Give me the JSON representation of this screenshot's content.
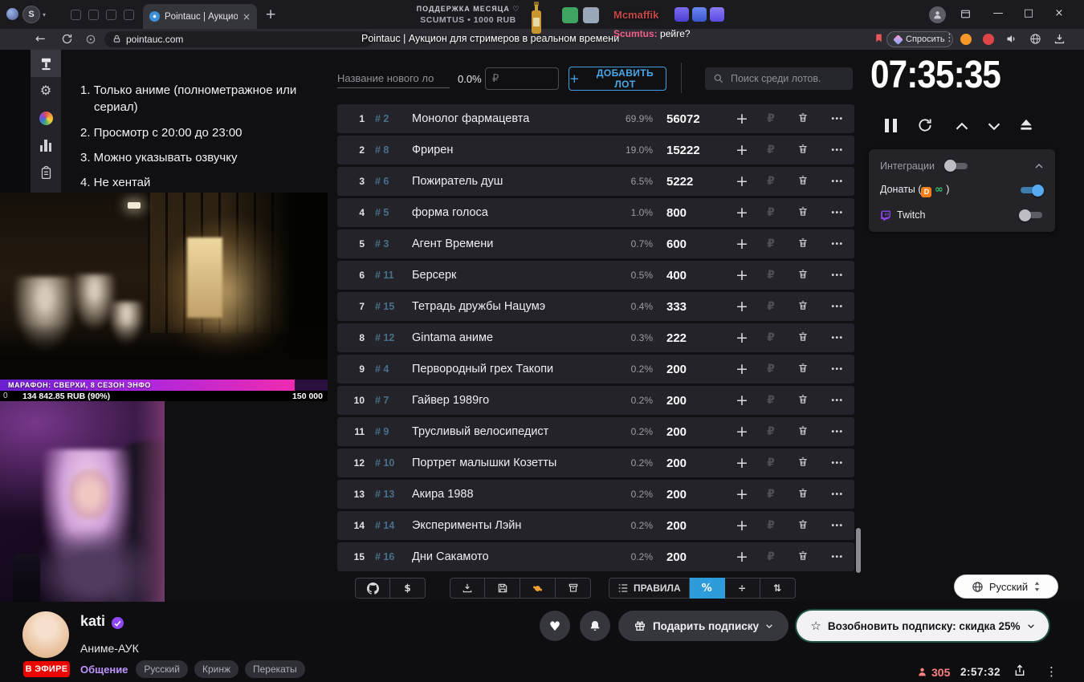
{
  "icons": {
    "plus": "+",
    "close": "×",
    "minimize": "—",
    "maximize": "□",
    "back_arrow": "←",
    "kebab": "⋮",
    "more_dots": "•••",
    "rub": "₽",
    "percent": "%",
    "divide": "÷",
    "sort": "⇅",
    "dollar": "$",
    "star": "☆",
    "heart": "♥",
    "infinity": "∞",
    "chevron_small": "▾",
    "gear": "⚙",
    "da": "D"
  },
  "browser": {
    "profile_initial": "S",
    "tab_title": "Pointauc | Аукцион для",
    "url": "pointauc.com",
    "ask_button": "Спросить",
    "page_title_overlay": "Pointauc | Аукцион для стримеров в реальном времени"
  },
  "overlay": {
    "support_caption": "ПОДДЕРЖКА МЕСЯЦА ♡",
    "support_value": "SCUMTUS • 1000 RUB",
    "chat_user": "Mcmaffik",
    "chat2_user": "Scumtus:",
    "chat2_text": "рейге?"
  },
  "rules": [
    "1. Только аниме (полнометражное или сериал)",
    "2. Просмотр с 20:00 до 23:00",
    "3. Можно указывать озвучку",
    "4. Не хентай"
  ],
  "marathon": {
    "title": "МАРАФОН: СВЕРХИ, 8 СЕЗОН ЭНФО",
    "min": "0",
    "current": "134 842.85 RUB (90%)",
    "goal": "150 000"
  },
  "auction": {
    "new_lot_placeholder": "Название нового ло",
    "percent_value": "0.0%",
    "currency_placeholder": "₽",
    "add_lot_button": "ДОБАВИТЬ ЛОТ",
    "search_placeholder": "Поиск среди лотов.",
    "rules_button": "ПРАВИЛА",
    "lots": [
      {
        "rank": "1",
        "id": "# 2",
        "name": "Монолог фармацевта",
        "percent": "69.9%",
        "amount": "56072"
      },
      {
        "rank": "2",
        "id": "# 8",
        "name": "Фрирен",
        "percent": "19.0%",
        "amount": "15222"
      },
      {
        "rank": "3",
        "id": "# 6",
        "name": "Пожиратель душ",
        "percent": "6.5%",
        "amount": "5222"
      },
      {
        "rank": "4",
        "id": "# 5",
        "name": "форма голоса",
        "percent": "1.0%",
        "amount": "800"
      },
      {
        "rank": "5",
        "id": "# 3",
        "name": "Агент Времени",
        "percent": "0.7%",
        "amount": "600"
      },
      {
        "rank": "6",
        "id": "# 11",
        "name": "Берсерк",
        "percent": "0.5%",
        "amount": "400"
      },
      {
        "rank": "7",
        "id": "# 15",
        "name": "Тетрадь дружбы Нацумэ",
        "percent": "0.4%",
        "amount": "333"
      },
      {
        "rank": "8",
        "id": "# 12",
        "name": "Gintama аниме",
        "percent": "0.3%",
        "amount": "222"
      },
      {
        "rank": "9",
        "id": "# 4",
        "name": "Первородный грех Такопи",
        "percent": "0.2%",
        "amount": "200"
      },
      {
        "rank": "10",
        "id": "# 7",
        "name": "Гайвер 1989го",
        "percent": "0.2%",
        "amount": "200"
      },
      {
        "rank": "11",
        "id": "# 9",
        "name": "Трусливый велосипедист",
        "percent": "0.2%",
        "amount": "200"
      },
      {
        "rank": "12",
        "id": "# 10",
        "name": "Портрет малышки Козетты",
        "percent": "0.2%",
        "amount": "200"
      },
      {
        "rank": "13",
        "id": "# 13",
        "name": "Акира 1988",
        "percent": "0.2%",
        "amount": "200"
      },
      {
        "rank": "14",
        "id": "# 14",
        "name": "Эксперименты Лэйн",
        "percent": "0.2%",
        "amount": "200"
      },
      {
        "rank": "15",
        "id": "# 16",
        "name": "Дни Сакамото",
        "percent": "0.2%",
        "amount": "200"
      }
    ]
  },
  "timer": {
    "value": "07:35:35"
  },
  "integrations": {
    "title": "Интеграции",
    "donate_prefix": "Донаты (",
    "donate_suffix": ")",
    "twitch_label": "Twitch"
  },
  "language": {
    "selected": "Русский"
  },
  "stream": {
    "channel": "kati",
    "category": "Аниме-АУК",
    "live_badge": "В ЭФИРЕ",
    "chat_link": "Общение",
    "tags": [
      "Русский",
      "Кринж",
      "Перекаты"
    ],
    "gift_button": "Подарить подписку",
    "resub_button": "Возобновить подписку: скидка 25%",
    "viewers": "305",
    "uptime": "2:57:32"
  }
}
